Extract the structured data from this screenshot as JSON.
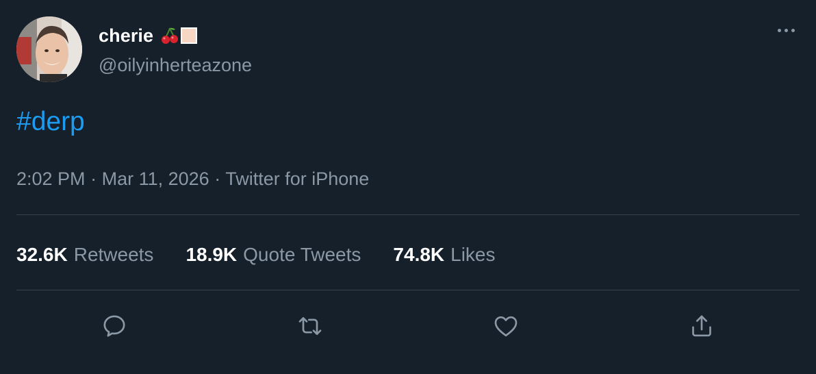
{
  "author": {
    "display_name": "cherie",
    "name_emoji": "cherries-emoji",
    "handle": "@oilyinherteazone"
  },
  "tweet": {
    "text": "#derp",
    "time": "2:02 PM",
    "separator": "·",
    "date": "Mar 11, 2026",
    "source": "Twitter for iPhone"
  },
  "stats": {
    "retweets_count": "32.6K",
    "retweets_label": "Retweets",
    "quotes_count": "18.9K",
    "quotes_label": "Quote Tweets",
    "likes_count": "74.8K",
    "likes_label": "Likes"
  },
  "actions": [
    {
      "icon": "reply-icon"
    },
    {
      "icon": "retweet-icon"
    },
    {
      "icon": "like-icon"
    },
    {
      "icon": "share-icon"
    }
  ],
  "colors": {
    "background": "#15202b",
    "accent": "#1d9bf0",
    "secondary_text": "#8b98a5",
    "divider": "#38444d"
  }
}
